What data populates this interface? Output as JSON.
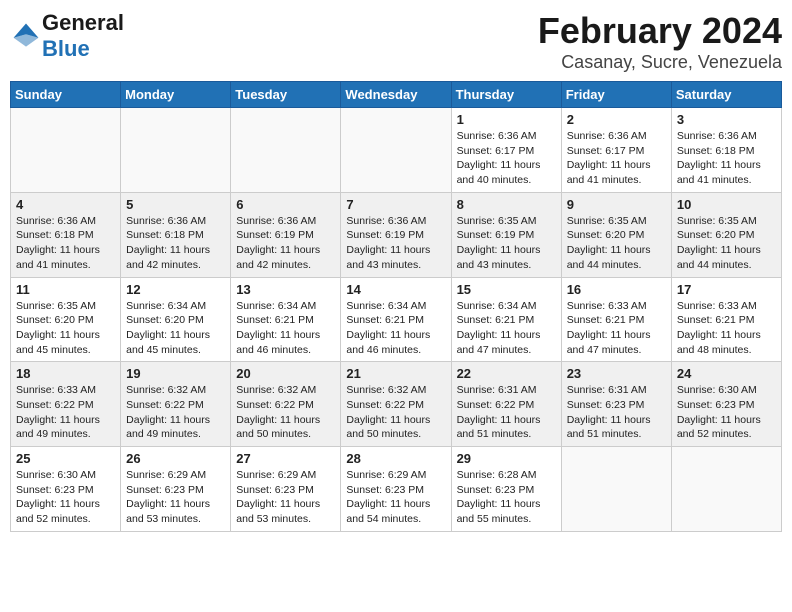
{
  "header": {
    "logo_general": "General",
    "logo_blue": "Blue",
    "month": "February 2024",
    "location": "Casanay, Sucre, Venezuela"
  },
  "weekdays": [
    "Sunday",
    "Monday",
    "Tuesday",
    "Wednesday",
    "Thursday",
    "Friday",
    "Saturday"
  ],
  "weeks": [
    [
      {
        "num": "",
        "info": ""
      },
      {
        "num": "",
        "info": ""
      },
      {
        "num": "",
        "info": ""
      },
      {
        "num": "",
        "info": ""
      },
      {
        "num": "1",
        "info": "Sunrise: 6:36 AM\nSunset: 6:17 PM\nDaylight: 11 hours\nand 40 minutes."
      },
      {
        "num": "2",
        "info": "Sunrise: 6:36 AM\nSunset: 6:17 PM\nDaylight: 11 hours\nand 41 minutes."
      },
      {
        "num": "3",
        "info": "Sunrise: 6:36 AM\nSunset: 6:18 PM\nDaylight: 11 hours\nand 41 minutes."
      }
    ],
    [
      {
        "num": "4",
        "info": "Sunrise: 6:36 AM\nSunset: 6:18 PM\nDaylight: 11 hours\nand 41 minutes."
      },
      {
        "num": "5",
        "info": "Sunrise: 6:36 AM\nSunset: 6:18 PM\nDaylight: 11 hours\nand 42 minutes."
      },
      {
        "num": "6",
        "info": "Sunrise: 6:36 AM\nSunset: 6:19 PM\nDaylight: 11 hours\nand 42 minutes."
      },
      {
        "num": "7",
        "info": "Sunrise: 6:36 AM\nSunset: 6:19 PM\nDaylight: 11 hours\nand 43 minutes."
      },
      {
        "num": "8",
        "info": "Sunrise: 6:35 AM\nSunset: 6:19 PM\nDaylight: 11 hours\nand 43 minutes."
      },
      {
        "num": "9",
        "info": "Sunrise: 6:35 AM\nSunset: 6:20 PM\nDaylight: 11 hours\nand 44 minutes."
      },
      {
        "num": "10",
        "info": "Sunrise: 6:35 AM\nSunset: 6:20 PM\nDaylight: 11 hours\nand 44 minutes."
      }
    ],
    [
      {
        "num": "11",
        "info": "Sunrise: 6:35 AM\nSunset: 6:20 PM\nDaylight: 11 hours\nand 45 minutes."
      },
      {
        "num": "12",
        "info": "Sunrise: 6:34 AM\nSunset: 6:20 PM\nDaylight: 11 hours\nand 45 minutes."
      },
      {
        "num": "13",
        "info": "Sunrise: 6:34 AM\nSunset: 6:21 PM\nDaylight: 11 hours\nand 46 minutes."
      },
      {
        "num": "14",
        "info": "Sunrise: 6:34 AM\nSunset: 6:21 PM\nDaylight: 11 hours\nand 46 minutes."
      },
      {
        "num": "15",
        "info": "Sunrise: 6:34 AM\nSunset: 6:21 PM\nDaylight: 11 hours\nand 47 minutes."
      },
      {
        "num": "16",
        "info": "Sunrise: 6:33 AM\nSunset: 6:21 PM\nDaylight: 11 hours\nand 47 minutes."
      },
      {
        "num": "17",
        "info": "Sunrise: 6:33 AM\nSunset: 6:21 PM\nDaylight: 11 hours\nand 48 minutes."
      }
    ],
    [
      {
        "num": "18",
        "info": "Sunrise: 6:33 AM\nSunset: 6:22 PM\nDaylight: 11 hours\nand 49 minutes."
      },
      {
        "num": "19",
        "info": "Sunrise: 6:32 AM\nSunset: 6:22 PM\nDaylight: 11 hours\nand 49 minutes."
      },
      {
        "num": "20",
        "info": "Sunrise: 6:32 AM\nSunset: 6:22 PM\nDaylight: 11 hours\nand 50 minutes."
      },
      {
        "num": "21",
        "info": "Sunrise: 6:32 AM\nSunset: 6:22 PM\nDaylight: 11 hours\nand 50 minutes."
      },
      {
        "num": "22",
        "info": "Sunrise: 6:31 AM\nSunset: 6:22 PM\nDaylight: 11 hours\nand 51 minutes."
      },
      {
        "num": "23",
        "info": "Sunrise: 6:31 AM\nSunset: 6:23 PM\nDaylight: 11 hours\nand 51 minutes."
      },
      {
        "num": "24",
        "info": "Sunrise: 6:30 AM\nSunset: 6:23 PM\nDaylight: 11 hours\nand 52 minutes."
      }
    ],
    [
      {
        "num": "25",
        "info": "Sunrise: 6:30 AM\nSunset: 6:23 PM\nDaylight: 11 hours\nand 52 minutes."
      },
      {
        "num": "26",
        "info": "Sunrise: 6:29 AM\nSunset: 6:23 PM\nDaylight: 11 hours\nand 53 minutes."
      },
      {
        "num": "27",
        "info": "Sunrise: 6:29 AM\nSunset: 6:23 PM\nDaylight: 11 hours\nand 53 minutes."
      },
      {
        "num": "28",
        "info": "Sunrise: 6:29 AM\nSunset: 6:23 PM\nDaylight: 11 hours\nand 54 minutes."
      },
      {
        "num": "29",
        "info": "Sunrise: 6:28 AM\nSunset: 6:23 PM\nDaylight: 11 hours\nand 55 minutes."
      },
      {
        "num": "",
        "info": ""
      },
      {
        "num": "",
        "info": ""
      }
    ]
  ]
}
